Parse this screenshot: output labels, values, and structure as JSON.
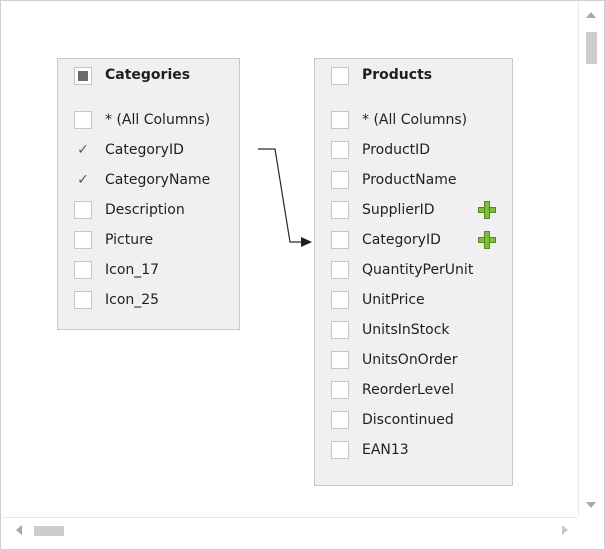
{
  "tables": [
    {
      "title": "Categories",
      "header_checkbox": "partial",
      "columns": [
        {
          "label": "* (All Columns)",
          "checked": false
        },
        {
          "label": "CategoryID",
          "checked": true
        },
        {
          "label": "CategoryName",
          "checked": true
        },
        {
          "label": "Description",
          "checked": false
        },
        {
          "label": "Picture",
          "checked": false
        },
        {
          "label": "Icon_17",
          "checked": false
        },
        {
          "label": "Icon_25",
          "checked": false
        }
      ]
    },
    {
      "title": "Products",
      "header_checkbox": "unchecked",
      "columns": [
        {
          "label": "* (All Columns)",
          "checked": false
        },
        {
          "label": "ProductID",
          "checked": false
        },
        {
          "label": "ProductName",
          "checked": false
        },
        {
          "label": "SupplierID",
          "checked": false,
          "key_icon": "plus-key-icon"
        },
        {
          "label": "CategoryID",
          "checked": false,
          "key_icon": "plus-key-icon"
        },
        {
          "label": "QuantityPerUnit",
          "checked": false
        },
        {
          "label": "UnitPrice",
          "checked": false
        },
        {
          "label": "UnitsInStock",
          "checked": false
        },
        {
          "label": "UnitsOnOrder",
          "checked": false
        },
        {
          "label": "ReorderLevel",
          "checked": false
        },
        {
          "label": "Discontinued",
          "checked": false
        },
        {
          "label": "EAN13",
          "checked": false
        }
      ]
    }
  ],
  "relation": {
    "from": "Categories.CategoryID",
    "to": "Products.CategoryID"
  },
  "colors": {
    "table_bg": "#f0f0f3",
    "table_border": "#c7c7cf",
    "key_icon": "#7fbe3a",
    "check": "#5a5a5a"
  }
}
